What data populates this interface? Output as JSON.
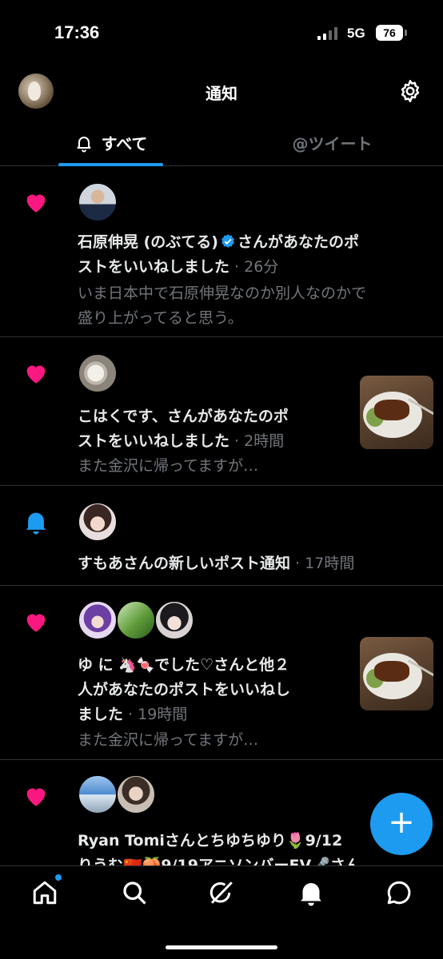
{
  "status_bar": {
    "time": "17:36",
    "network": "5G",
    "battery": "76"
  },
  "header": {
    "title": "通知"
  },
  "tabs": [
    {
      "label": "すべて",
      "active": true
    },
    {
      "label": "@ツイート",
      "active": false
    }
  ],
  "notifications": [
    {
      "type": "like",
      "icon": "heart-icon",
      "name": "石原伸晃 (のぶてる)",
      "verified": true,
      "line1_rest": "さんがあなたのポ",
      "line2": "ストをいいねしました",
      "time": "26分",
      "sub1": "いま日本中で石原伸晃なのか別人なのかで",
      "sub2": "盛り上がってると思う。"
    },
    {
      "type": "like",
      "icon": "heart-icon",
      "line1": "こはくです、さんがあなたのポ",
      "line2": "ストをいいねしました",
      "time": "2時間",
      "sub1": "また金沢に帰ってますが…"
    },
    {
      "type": "new_post",
      "icon": "bell-icon",
      "line1": "すもあさんの新しいポスト通知",
      "time": "17時間"
    },
    {
      "type": "like",
      "icon": "heart-icon",
      "line1_a": "ゆ に ",
      "line1_b": "でした♡さんと他２",
      "line2": "人があなたのポストをいいねし",
      "line3": "ました",
      "time": "19時間",
      "sub1": "また金沢に帰ってますが…"
    },
    {
      "type": "like",
      "icon": "heart-icon",
      "line1": "Ryan Tomiさんとちゆちゆり🌷9/12",
      "line2": "りうむ🇨🇳🍑9/19アニソンバーEV🎤さん"
    }
  ],
  "colors": {
    "accent": "#1d9bf0",
    "like": "#f91880",
    "muted": "#71767b"
  },
  "bottom_nav": [
    "home-icon",
    "search-icon",
    "grok-icon",
    "notifications-icon",
    "messages-icon"
  ]
}
